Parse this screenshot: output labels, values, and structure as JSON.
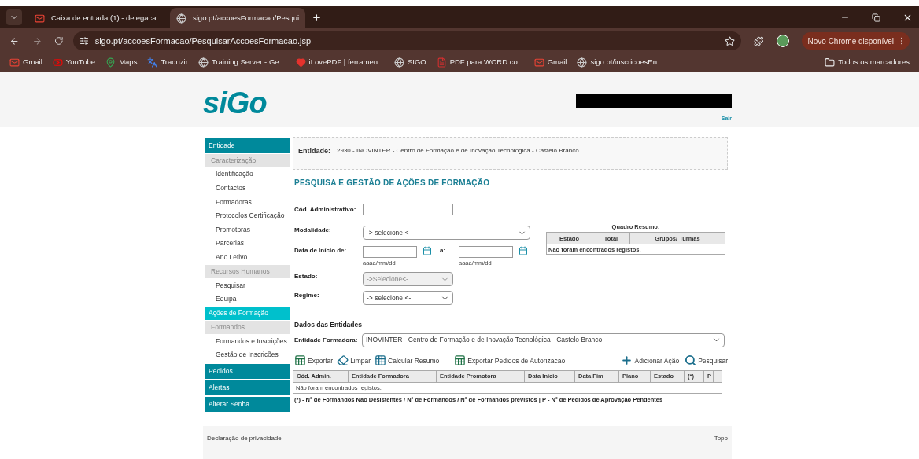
{
  "browser": {
    "tabs": [
      {
        "title": "Caixa de entrada (1) - delegaca",
        "kind": "gmail",
        "selected": false
      },
      {
        "title": "sigo.pt/accoesFormacao/Pesqui",
        "kind": "globe",
        "selected": true
      }
    ],
    "url": "sigo.pt/accoesFormacao/PesquisarAccoesFormacao.jsp",
    "update_button": "Novo Chrome disponível",
    "bookmarks": [
      {
        "label": "Gmail",
        "kind": "gmail"
      },
      {
        "label": "YouTube",
        "kind": "youtube"
      },
      {
        "label": "Maps",
        "kind": "maps"
      },
      {
        "label": "Traduzir",
        "kind": "translate"
      },
      {
        "label": "Training Server - Ge...",
        "kind": "globe"
      },
      {
        "label": "iLovePDF | ferramen...",
        "kind": "heart"
      },
      {
        "label": "SIGO",
        "kind": "globe"
      },
      {
        "label": "PDF para WORD co...",
        "kind": "pdf"
      },
      {
        "label": "Gmail",
        "kind": "gmail"
      },
      {
        "label": "sigo.pt/inscricoesEn...",
        "kind": "globe"
      }
    ],
    "all_bookmarks": "Todos os marcadores"
  },
  "header": {
    "logo": "siGo",
    "logout": "Sair"
  },
  "sidebar": [
    {
      "label": "Entidade",
      "kind": "section",
      "selected": false
    },
    {
      "label": "Caracterização",
      "kind": "group",
      "selected": false
    },
    {
      "label": "Identificação",
      "kind": "item",
      "selected": false
    },
    {
      "label": "Contactos",
      "kind": "item",
      "selected": false
    },
    {
      "label": "Formadoras",
      "kind": "item",
      "selected": false
    },
    {
      "label": "Protocolos Certificação",
      "kind": "item",
      "selected": false
    },
    {
      "label": "Promotoras",
      "kind": "item",
      "selected": false
    },
    {
      "label": "Parcerias",
      "kind": "item",
      "selected": false
    },
    {
      "label": "Ano Letivo",
      "kind": "item",
      "selected": false
    },
    {
      "label": "Recursos Humanos",
      "kind": "group",
      "selected": false
    },
    {
      "label": "Pesquisar",
      "kind": "item",
      "selected": false
    },
    {
      "label": "Equipa",
      "kind": "item",
      "selected": false
    },
    {
      "label": "Ações de Formação",
      "kind": "group",
      "selected": true
    },
    {
      "label": "Formandos",
      "kind": "group",
      "selected": false
    },
    {
      "label": "Formandos e Inscrições",
      "kind": "item",
      "selected": false
    },
    {
      "label": "Gestão de Inscricões",
      "kind": "item",
      "selected": false
    },
    {
      "label": "Pedidos",
      "kind": "section",
      "selected": false
    },
    {
      "label": "Alertas",
      "kind": "section",
      "selected": false
    },
    {
      "label": "Alterar Senha",
      "kind": "section",
      "selected": false
    }
  ],
  "entity": {
    "label": "Entidade:",
    "value": "2930 - INOVINTER - Centro de Formação e de Inovação Tecnológica - Castelo Branco"
  },
  "title": "PESQUISA E GESTÃO DE AÇÕES DE FORMAÇÃO",
  "form": {
    "cod": {
      "label": "Cód. Administrativo:"
    },
    "modalidade": {
      "label": "Modalidade:",
      "value": "-> selecione <-"
    },
    "data": {
      "label": "Data de Início de:",
      "to": "a:",
      "hint_from": "aaaa/mm/dd",
      "hint_to": "aaaa/mm/dd"
    },
    "estado": {
      "label": "Estado:",
      "value": "->Selecione<-",
      "disabled": true
    },
    "regime": {
      "label": "Regime:",
      "value": "-> selecione <-"
    }
  },
  "summary": {
    "title": "Quadro Resumo:",
    "columns": [
      "Estado",
      "Total",
      "Grupos/ Turmas"
    ],
    "empty": "Não foram encontrados registos."
  },
  "entities": {
    "title": "Dados das Entidades",
    "label": "Entidade Formadora:",
    "value": "INOVINTER - Centro de Formação e de Inovação Tecnológica - Castelo Branco"
  },
  "actions": [
    {
      "label": "Exportar",
      "kind": "excel"
    },
    {
      "label": "Limpar",
      "kind": "eraser"
    },
    {
      "label": "Calcular Resumo",
      "kind": "grid"
    },
    {
      "label": "Exportar Pedidos de Autorizacao",
      "kind": "excel"
    }
  ],
  "actions_right": [
    {
      "label": "Adicionar Ação",
      "kind": "plus"
    },
    {
      "label": "Pesquisar",
      "kind": "search"
    }
  ],
  "table": {
    "columns": [
      "Cód. Admin.",
      "Entidade Formadora",
      "Entidade Promotora",
      "Data Início",
      "Data Fim",
      "Plano",
      "Estado",
      "(*)",
      "P"
    ],
    "empty": "Não foram encontrados registos."
  },
  "legend": "(*) - Nº de Formandos Não Desistentes / Nº de Formandos / Nº de Formandos previstos | P - Nº de Pedidos de Aprovação Pendentes",
  "footer": {
    "privacy": "Declaração de privacidade",
    "top": "Topo"
  }
}
